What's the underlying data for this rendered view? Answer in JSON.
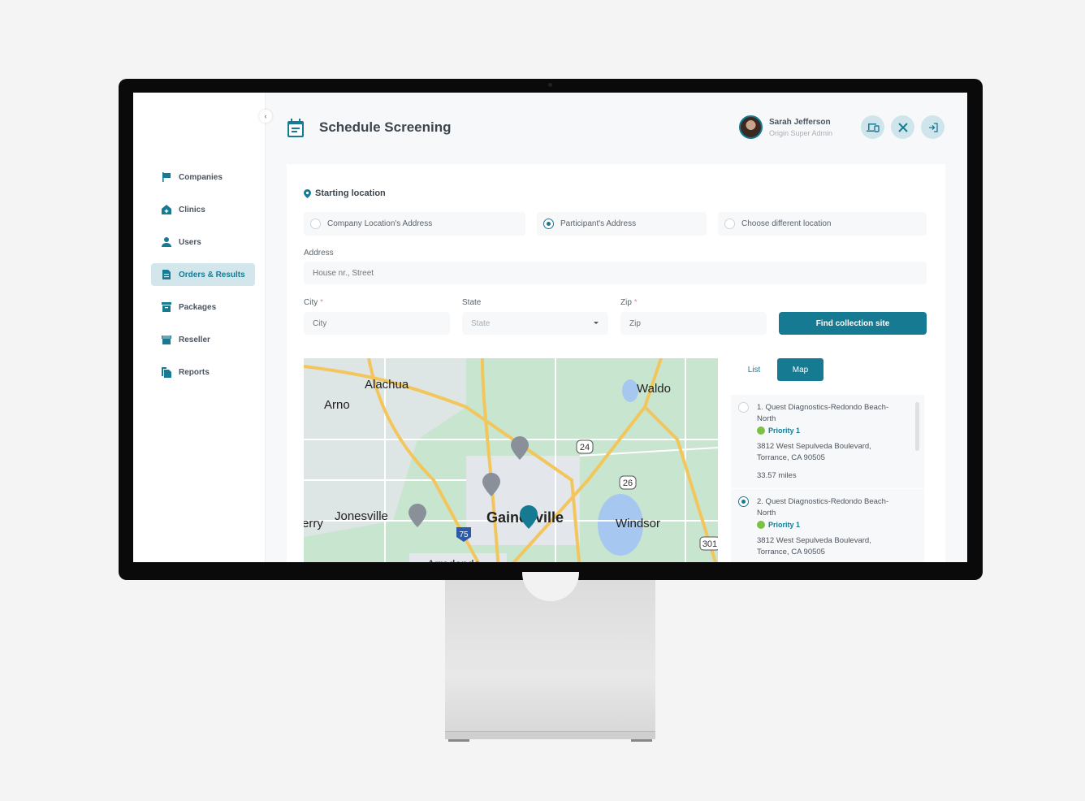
{
  "app": {
    "title": "Schedule Screening",
    "collapse_icon": "chevron-left-icon"
  },
  "user": {
    "name": "Sarah Jefferson",
    "role": "Origin Super Admin"
  },
  "header_buttons": [
    {
      "name": "devices-button",
      "icon": "devices-icon"
    },
    {
      "name": "tools-button",
      "icon": "tools-icon"
    },
    {
      "name": "logout-button",
      "icon": "logout-icon"
    }
  ],
  "sidebar": {
    "items": [
      {
        "label": "Companies",
        "icon": "flag-icon",
        "active": false
      },
      {
        "label": "Clinics",
        "icon": "clinic-icon",
        "active": false
      },
      {
        "label": "Users",
        "icon": "user-icon",
        "active": false
      },
      {
        "label": "Orders & Results",
        "icon": "document-icon",
        "active": true
      },
      {
        "label": "Packages",
        "icon": "package-icon",
        "active": false
      },
      {
        "label": "Reseller",
        "icon": "store-icon",
        "active": false
      },
      {
        "label": "Reports",
        "icon": "reports-icon",
        "active": false
      }
    ]
  },
  "form": {
    "section_title": "Starting location",
    "location_options": [
      {
        "label": "Company Location's Address",
        "checked": false
      },
      {
        "label": "Participant's Address",
        "checked": true
      },
      {
        "label": "Choose different location",
        "checked": false
      }
    ],
    "address": {
      "label": "Address",
      "placeholder": "House nr., Street",
      "value": ""
    },
    "city": {
      "label": "City",
      "required_mark": "*",
      "placeholder": "City",
      "value": ""
    },
    "state": {
      "label": "State",
      "placeholder": "State",
      "value": ""
    },
    "zip": {
      "label": "Zip",
      "required_mark": "*",
      "placeholder": "Zip",
      "value": ""
    },
    "find_button": "Find collection site"
  },
  "view_toggle": {
    "list_label": "List",
    "map_label": "Map",
    "selected": "Map"
  },
  "map": {
    "places": [
      "Alachua",
      "Arno",
      "Waldo",
      "Jonesville",
      "Gainesville",
      "Windsor",
      "Arredondo",
      "erry"
    ],
    "route_shields": [
      "24",
      "26",
      "75",
      "301"
    ],
    "colors": {
      "land": "#c8e6cf",
      "urban": "#e3e6ea",
      "road": "#f2c65c",
      "water": "#a6c8f0",
      "pin": "#8a9099",
      "pin_selected": "#177a93"
    }
  },
  "results": [
    {
      "title": "1. Quest Diagnostics-Redondo Beach-North",
      "priority": "Priority 1",
      "address_line1": "3812 West Sepulveda Boulevard,",
      "address_line2": "Torrance, CA 90505",
      "distance": "33.57 miles",
      "selected": false
    },
    {
      "title": "2. Quest Diagnostics-Redondo Beach-North",
      "priority": "Priority 1",
      "address_line1": "3812 West Sepulveda Boulevard,",
      "address_line2": "Torrance, CA 90505",
      "distance": "",
      "selected": true
    }
  ],
  "colors": {
    "accent": "#177a93",
    "active_nav_bg": "#d3e6ec",
    "priority_dot": "#7cc142"
  }
}
